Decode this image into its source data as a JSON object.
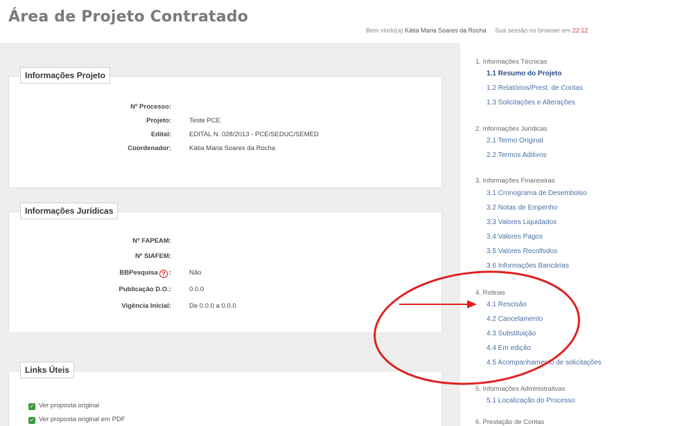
{
  "header": {
    "title": "Área de Projeto Contratado",
    "welcome_prefix": "Bem vindo(a)",
    "user_name": "Kátia Maria Soares da Rocha",
    "session_prefix": "Sua sessão no browser em",
    "session_time": "22:12"
  },
  "project_info": {
    "title": "Informações Projeto",
    "fields": [
      {
        "label": "Nº Processo:",
        "value": ""
      },
      {
        "label": "Projeto:",
        "value": "Teste PCE"
      },
      {
        "label": "Edital:",
        "value": "EDITAL N. 028/2013 - PCE/SEDUC/SEMED"
      },
      {
        "label": "Coordenador:",
        "value": "Kátia Maria Soares da Rocha"
      }
    ]
  },
  "legal_info": {
    "title": "Informações Jurídicas",
    "fields": [
      {
        "label": "Nº FAPEAM:",
        "value": ""
      },
      {
        "label": "Nº SIAFEM:",
        "value": ""
      },
      {
        "label": "BBPesquisa",
        "value": "Não"
      },
      {
        "label": "Publicação D.O.:",
        "value": "0.0.0"
      },
      {
        "label": "Vigência Inicial:",
        "value": "De 0.0.0 a 0.0.0"
      }
    ]
  },
  "useful_links": {
    "title": "Links Úteis",
    "items": [
      {
        "label": "Ver proposta original"
      },
      {
        "label": "Ver proposta original em PDF"
      }
    ]
  },
  "sidebar": {
    "sections": [
      {
        "heading": "1. Informações Técnicas",
        "items": [
          {
            "label": "1.1 Resumo do Projeto",
            "active": true
          },
          {
            "label": "1.2 Relatórios/Prest. de Contas"
          },
          {
            "label": "1.3 Solicitações e Alterações"
          }
        ]
      },
      {
        "heading": "2. Informações Jurídicas",
        "items": [
          {
            "label": "2.1 Termo Original"
          },
          {
            "label": "2.2 Termos Aditivos"
          }
        ]
      },
      {
        "heading": "3. Informações Financeiras",
        "items": [
          {
            "label": "3.1 Cronograma de Desembolso"
          },
          {
            "label": "3.2 Notas de Empenho"
          },
          {
            "label": "3.3 Valores Liquidados"
          },
          {
            "label": "3.4 Valores Pagos"
          },
          {
            "label": "3.5 Valores Recolhidos"
          },
          {
            "label": "3.6 Informações Bancárias"
          }
        ]
      },
      {
        "heading": "4. Rotinas",
        "items": [
          {
            "label": "4.1 Rescisão"
          },
          {
            "label": "4.2 Cancelamento"
          },
          {
            "label": "4.3 Substituição"
          },
          {
            "label": "4.4 Em edição"
          },
          {
            "label": "4.5 Acompanhamento de solicitações"
          }
        ]
      },
      {
        "heading": "5. Informações Administrativas",
        "items": [
          {
            "label": "5.1 Localização do Processo"
          }
        ]
      },
      {
        "heading": "6. Prestação de Contas",
        "items": []
      }
    ]
  },
  "annotation": {
    "color": "#e02020"
  }
}
